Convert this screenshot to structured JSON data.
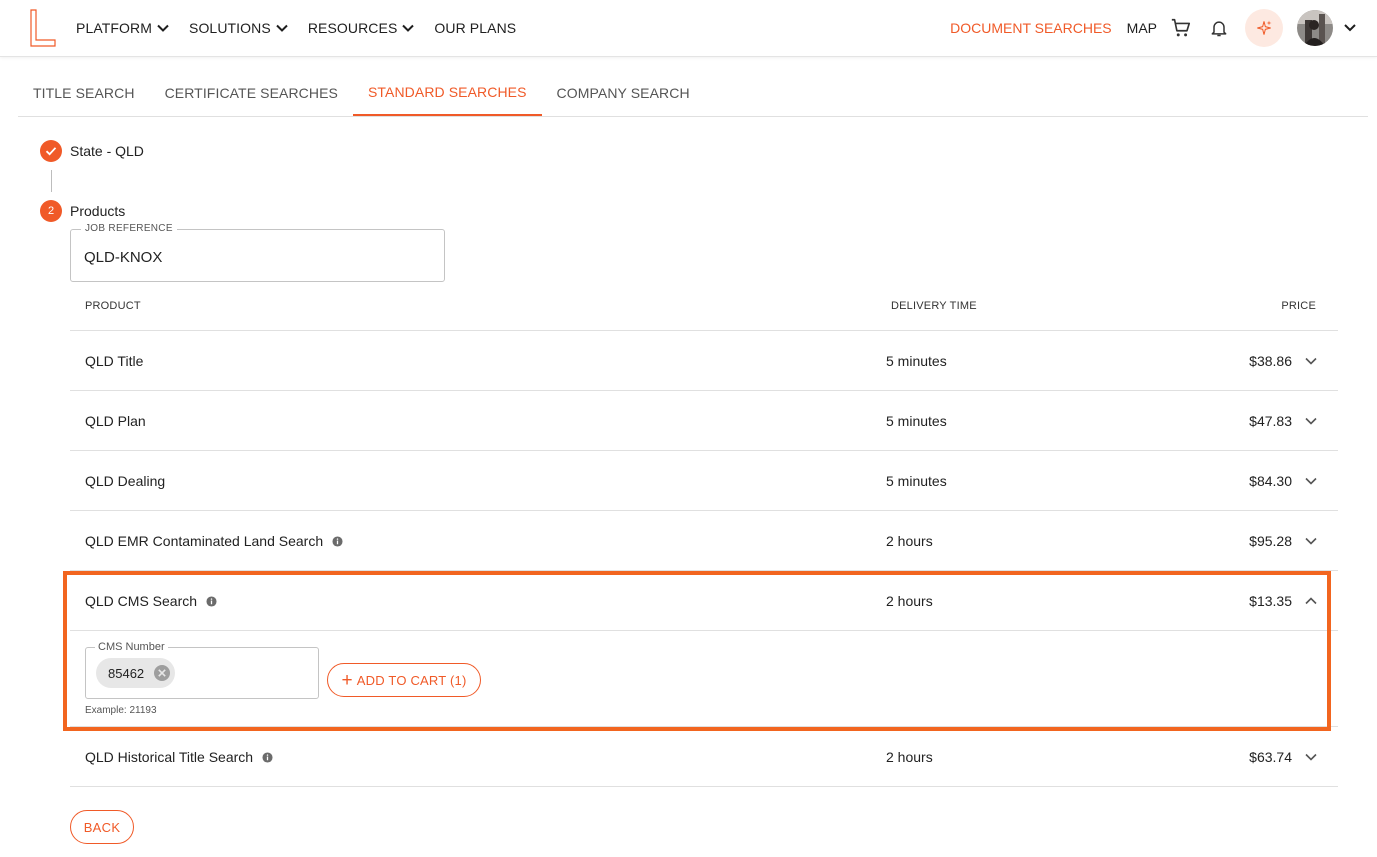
{
  "colors": {
    "accent": "#f05a28",
    "highlight": "#f2651f",
    "chip_bg": "#e7e7e7"
  },
  "nav": {
    "menu": [
      {
        "label": "PLATFORM",
        "has_dropdown": true
      },
      {
        "label": "SOLUTIONS",
        "has_dropdown": true
      },
      {
        "label": "RESOURCES",
        "has_dropdown": true
      },
      {
        "label": "OUR PLANS",
        "has_dropdown": false
      }
    ],
    "document_searches": "DOCUMENT SEARCHES",
    "map": "MAP",
    "icons": [
      "cart-icon",
      "bell-icon",
      "sparkle-icon",
      "avatar",
      "chevron-down-icon"
    ]
  },
  "tabs": [
    {
      "label": "TITLE SEARCH",
      "active": false
    },
    {
      "label": "CERTIFICATE SEARCHES",
      "active": false
    },
    {
      "label": "STANDARD SEARCHES",
      "active": true
    },
    {
      "label": "COMPANY SEARCH",
      "active": false
    }
  ],
  "steps": [
    {
      "label": "State - QLD",
      "status": "complete",
      "icon": "check-icon"
    },
    {
      "label": "Products",
      "status": "active",
      "number": "2"
    }
  ],
  "job_reference": {
    "label": "JOB REFERENCE",
    "value": "QLD-KNOX"
  },
  "table": {
    "headers": {
      "product": "PRODUCT",
      "delivery": "DELIVERY TIME",
      "price": "PRICE"
    },
    "rows": [
      {
        "name": "QLD Title",
        "delivery": "5 minutes",
        "price": "$38.86",
        "info": false,
        "expanded": false
      },
      {
        "name": "QLD Plan",
        "delivery": "5 minutes",
        "price": "$47.83",
        "info": false,
        "expanded": false
      },
      {
        "name": "QLD Dealing",
        "delivery": "5 minutes",
        "price": "$84.30",
        "info": false,
        "expanded": false
      },
      {
        "name": "QLD EMR Contaminated Land Search",
        "delivery": "2 hours",
        "price": "$95.28",
        "info": true,
        "expanded": false
      },
      {
        "name": "QLD CMS Search",
        "delivery": "2 hours",
        "price": "$13.35",
        "info": true,
        "expanded": true
      },
      {
        "name": "QLD Historical Title Search",
        "delivery": "2 hours",
        "price": "$63.74",
        "info": true,
        "expanded": false
      }
    ]
  },
  "cms_panel": {
    "field_label": "CMS Number",
    "chip_value": "85462",
    "helper": "Example: 21193",
    "add_button": "ADD TO CART (1)"
  },
  "back_button": "BACK"
}
